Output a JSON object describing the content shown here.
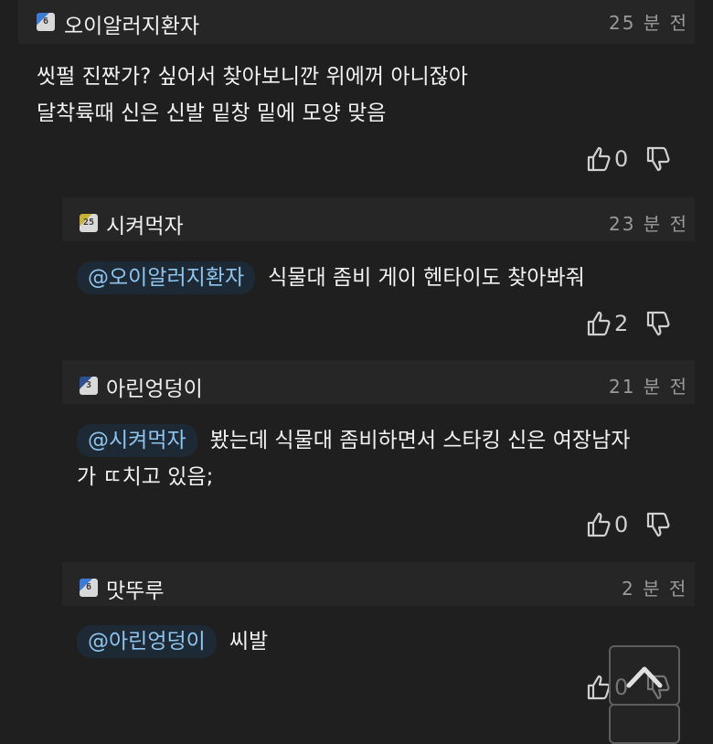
{
  "comments": [
    {
      "user": "오이알러지환자",
      "badge": "6",
      "time": "25 분 전",
      "lines": [
        "씻펄 진짠가? 싶어서 찾아보니깐 위에꺼 아니잖아",
        "달착륙때 신은 신발 밑창 밑에 모양 맞음"
      ],
      "likes": "0"
    },
    {
      "user": "시켜먹자",
      "badge": "25",
      "time": "23 분 전",
      "mention": "@오이알러지환자",
      "text": "식물대 좀비 게이 헨타이도 찾아봐줘",
      "likes": "2"
    },
    {
      "user": "아린엉덩이",
      "badge": "3",
      "time": "21 분 전",
      "mention": "@시켜먹자",
      "text": "봤는데 식물대 좀비하면서 스타킹 신은 여장남자",
      "text2": "가 ㄸ치고 있음;",
      "likes": "0"
    },
    {
      "user": "맛뚜루",
      "badge": "6",
      "time": "2 분 전",
      "mention": "@아린엉덩이",
      "text": "씨발",
      "likes": "0"
    }
  ],
  "icons": {
    "like": "thumbs-up-icon",
    "dislike": "thumbs-down-icon",
    "scroll_top": "chevron-up-icon"
  }
}
